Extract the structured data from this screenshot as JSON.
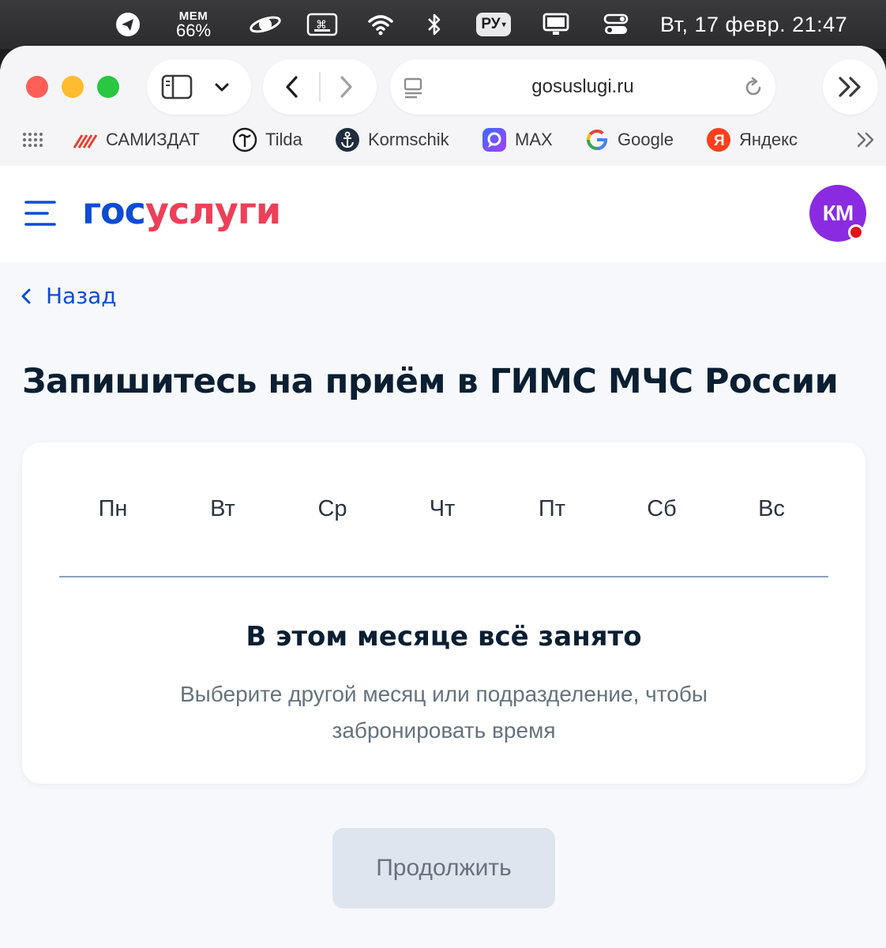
{
  "menubar": {
    "mem_label": "MEM",
    "mem_value": "66%",
    "input_language": "РУ",
    "clock": "Вт, 17 февр.  21:47"
  },
  "browser": {
    "url": "gosuslugi.ru",
    "bookmarks": [
      {
        "label": "САМИЗДАТ",
        "icon": "samizdat-icon"
      },
      {
        "label": "Tilda",
        "icon": "tilda-icon"
      },
      {
        "label": "Kormschik",
        "icon": "anchor-icon"
      },
      {
        "label": "MAX",
        "icon": "max-icon"
      },
      {
        "label": "Google",
        "icon": "google-icon"
      },
      {
        "label": "Яндекс",
        "icon": "yandex-icon"
      }
    ]
  },
  "site": {
    "logo_part1": "гос",
    "logo_part2": "услуги",
    "avatar_initials": "КМ",
    "colors": {
      "brand_blue": "#0d4cd3",
      "brand_red": "#ee3f58",
      "avatar": "#8a2be2"
    }
  },
  "main": {
    "back_label": "Назад",
    "title": "Запишитесь на приём в ГИМС МЧС России",
    "weekdays": [
      "Пн",
      "Вт",
      "Ср",
      "Чт",
      "Пт",
      "Сб",
      "Вс"
    ],
    "empty_title": "В этом месяце всё занято",
    "empty_desc_line1": "Выберите другой месяц или подразделение, чтобы",
    "empty_desc_line2": "забронировать время",
    "continue_label": "Продолжить"
  }
}
